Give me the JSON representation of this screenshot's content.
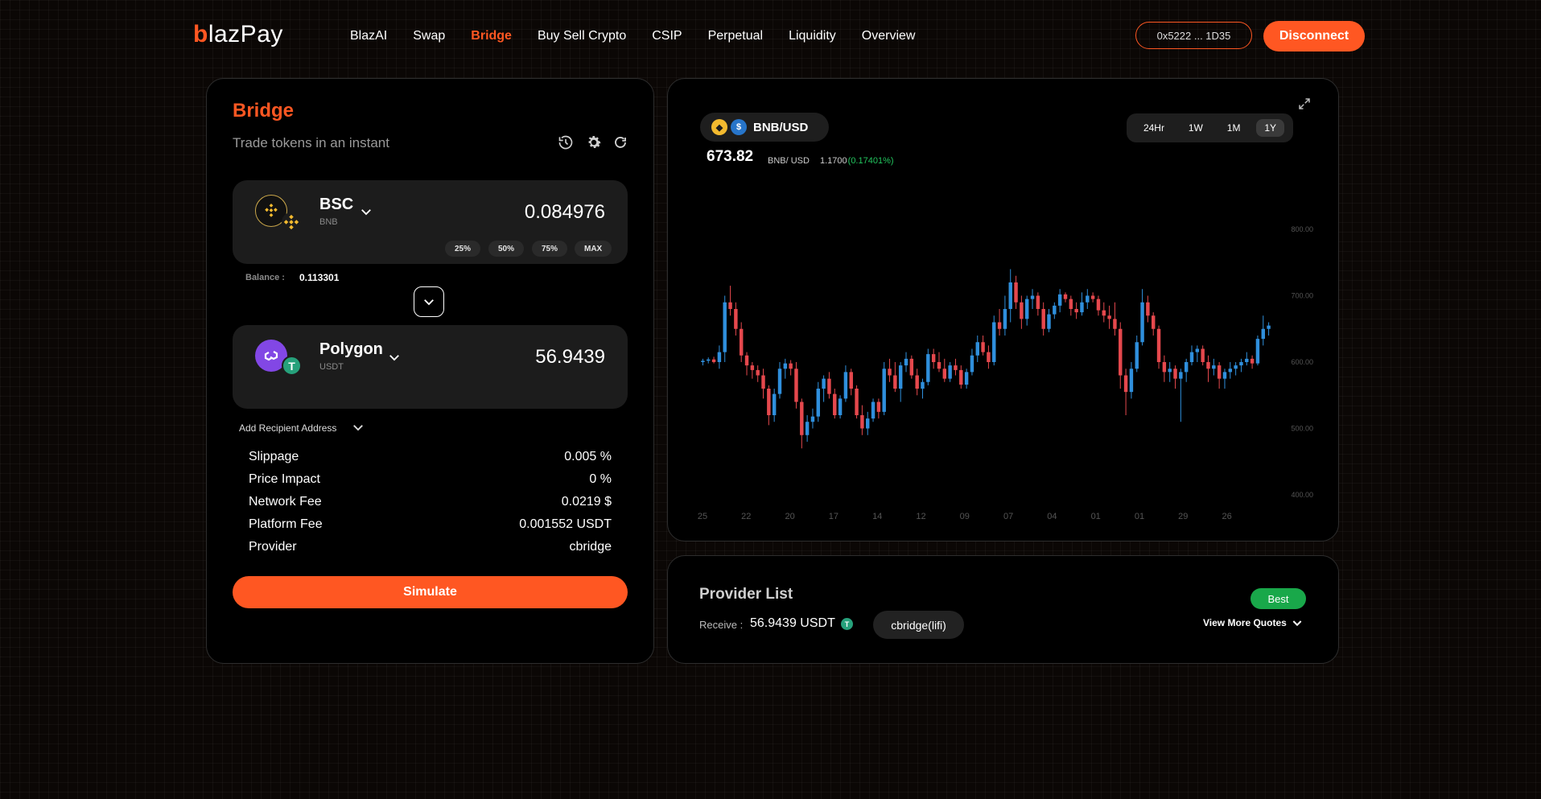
{
  "brand": {
    "logo_first": "b",
    "logo_rest": "lazPay"
  },
  "nav": {
    "items": [
      {
        "label": "BlazAI",
        "active": false
      },
      {
        "label": "Swap",
        "active": false
      },
      {
        "label": "Bridge",
        "active": true
      },
      {
        "label": "Buy Sell Crypto",
        "active": false
      },
      {
        "label": "CSIP",
        "active": false
      },
      {
        "label": "Perpetual",
        "active": false
      },
      {
        "label": "Liquidity",
        "active": false
      },
      {
        "label": "Overview",
        "active": false
      }
    ],
    "wallet_address": "0x5222 ... 1D35",
    "disconnect_label": "Disconnect"
  },
  "bridge": {
    "title": "Bridge",
    "subtitle": "Trade tokens in an instant",
    "from": {
      "chain": "BSC",
      "token": "BNB",
      "amount": "0.084976"
    },
    "pct_buttons": [
      "25%",
      "50%",
      "75%",
      "MAX"
    ],
    "balance_label": "Balance :",
    "balance_value": "0.113301",
    "to": {
      "chain": "Polygon",
      "token": "USDT",
      "amount": "56.9439"
    },
    "recipient_label": "Add Recipient Address",
    "details": [
      {
        "label": "Slippage",
        "value": "0.005 %"
      },
      {
        "label": "Price Impact",
        "value": "0 %"
      },
      {
        "label": "Network Fee",
        "value": "0.0219 $"
      },
      {
        "label": "Platform Fee",
        "value": "0.001552 USDT"
      },
      {
        "label": "Provider",
        "value": "cbridge"
      }
    ],
    "simulate_label": "Simulate"
  },
  "chart": {
    "pair": "BNB/USD",
    "price": "673.82",
    "price_unit": "BNB/ USD",
    "change_abs": "1.1700",
    "change_pct": "(0.17401%)",
    "timeframes": [
      {
        "label": "24Hr",
        "active": false
      },
      {
        "label": "1W",
        "active": false
      },
      {
        "label": "1M",
        "active": false
      },
      {
        "label": "1Y",
        "active": true
      }
    ],
    "colors": {
      "up": "#2f8fdc",
      "down": "#e5484d",
      "accent": "#ff5722",
      "positive": "#22c55e"
    }
  },
  "chart_data": {
    "type": "candlestick",
    "title": "",
    "xlabel": "",
    "ylabel": "",
    "x_ticks": [
      "25",
      "22",
      "20",
      "17",
      "14",
      "12",
      "09",
      "07",
      "04",
      "01",
      "01",
      "29",
      "26"
    ],
    "y_ticks": [
      "800.00",
      "700.00",
      "600.00",
      "500.00",
      "400.00"
    ],
    "ylim": [
      400,
      800
    ],
    "grid": false,
    "candles": [
      [
        600,
        605,
        595,
        602
      ],
      [
        602,
        607,
        598,
        604
      ],
      [
        604,
        608,
        598,
        600
      ],
      [
        600,
        625,
        590,
        615
      ],
      [
        615,
        700,
        600,
        690
      ],
      [
        690,
        715,
        670,
        680
      ],
      [
        680,
        690,
        640,
        650
      ],
      [
        650,
        660,
        600,
        610
      ],
      [
        610,
        615,
        580,
        595
      ],
      [
        595,
        600,
        575,
        588
      ],
      [
        588,
        595,
        570,
        580
      ],
      [
        580,
        590,
        545,
        560
      ],
      [
        560,
        565,
        505,
        520
      ],
      [
        520,
        560,
        510,
        552
      ],
      [
        552,
        600,
        545,
        590
      ],
      [
        590,
        605,
        575,
        598
      ],
      [
        598,
        603,
        580,
        590
      ],
      [
        590,
        600,
        530,
        540
      ],
      [
        540,
        545,
        470,
        490
      ],
      [
        490,
        520,
        480,
        510
      ],
      [
        510,
        530,
        500,
        518
      ],
      [
        518,
        570,
        510,
        560
      ],
      [
        560,
        580,
        540,
        575
      ],
      [
        575,
        585,
        545,
        552
      ],
      [
        552,
        560,
        515,
        520
      ],
      [
        520,
        550,
        515,
        545
      ],
      [
        545,
        595,
        540,
        585
      ],
      [
        585,
        590,
        550,
        560
      ],
      [
        560,
        565,
        515,
        520
      ],
      [
        520,
        535,
        490,
        500
      ],
      [
        500,
        525,
        490,
        515
      ],
      [
        515,
        545,
        510,
        540
      ],
      [
        540,
        545,
        515,
        525
      ],
      [
        525,
        600,
        520,
        590
      ],
      [
        590,
        605,
        570,
        580
      ],
      [
        580,
        600,
        555,
        560
      ],
      [
        560,
        600,
        540,
        595
      ],
      [
        595,
        615,
        585,
        605
      ],
      [
        605,
        610,
        575,
        580
      ],
      [
        580,
        590,
        550,
        560
      ],
      [
        560,
        575,
        545,
        570
      ],
      [
        570,
        620,
        565,
        612
      ],
      [
        612,
        620,
        590,
        600
      ],
      [
        600,
        615,
        585,
        590
      ],
      [
        590,
        605,
        570,
        575
      ],
      [
        575,
        600,
        570,
        595
      ],
      [
        595,
        605,
        580,
        588
      ],
      [
        588,
        595,
        560,
        566
      ],
      [
        566,
        590,
        560,
        585
      ],
      [
        585,
        620,
        580,
        610
      ],
      [
        610,
        640,
        600,
        630
      ],
      [
        630,
        640,
        610,
        615
      ],
      [
        615,
        625,
        590,
        600
      ],
      [
        600,
        670,
        595,
        660
      ],
      [
        660,
        680,
        640,
        650
      ],
      [
        650,
        700,
        640,
        680
      ],
      [
        680,
        740,
        660,
        720
      ],
      [
        720,
        730,
        680,
        690
      ],
      [
        690,
        700,
        650,
        665
      ],
      [
        665,
        700,
        655,
        695
      ],
      [
        695,
        710,
        680,
        700
      ],
      [
        700,
        705,
        670,
        680
      ],
      [
        680,
        690,
        640,
        650
      ],
      [
        650,
        680,
        645,
        672
      ],
      [
        672,
        690,
        665,
        685
      ],
      [
        685,
        710,
        675,
        702
      ],
      [
        702,
        705,
        690,
        695
      ],
      [
        695,
        700,
        670,
        680
      ],
      [
        680,
        690,
        665,
        675
      ],
      [
        675,
        705,
        670,
        690
      ],
      [
        690,
        710,
        680,
        700
      ],
      [
        700,
        705,
        690,
        695
      ],
      [
        695,
        700,
        670,
        678
      ],
      [
        678,
        690,
        660,
        670
      ],
      [
        670,
        685,
        650,
        665
      ],
      [
        665,
        690,
        640,
        650
      ],
      [
        650,
        660,
        560,
        580
      ],
      [
        580,
        590,
        520,
        555
      ],
      [
        555,
        600,
        545,
        590
      ],
      [
        590,
        640,
        585,
        630
      ],
      [
        630,
        710,
        625,
        690
      ],
      [
        690,
        700,
        660,
        670
      ],
      [
        670,
        675,
        640,
        650
      ],
      [
        650,
        655,
        590,
        600
      ],
      [
        600,
        610,
        570,
        585
      ],
      [
        585,
        600,
        570,
        590
      ],
      [
        590,
        595,
        560,
        575
      ],
      [
        575,
        590,
        510,
        585
      ],
      [
        585,
        605,
        570,
        600
      ],
      [
        600,
        625,
        595,
        615
      ],
      [
        615,
        625,
        600,
        620
      ],
      [
        620,
        625,
        595,
        600
      ],
      [
        600,
        610,
        570,
        590
      ],
      [
        590,
        605,
        580,
        595
      ],
      [
        595,
        600,
        560,
        575
      ],
      [
        575,
        590,
        560,
        585
      ],
      [
        585,
        600,
        575,
        590
      ],
      [
        590,
        600,
        580,
        595
      ],
      [
        595,
        605,
        585,
        600
      ],
      [
        600,
        615,
        595,
        605
      ],
      [
        605,
        610,
        590,
        598
      ],
      [
        598,
        640,
        595,
        635
      ],
      [
        635,
        670,
        625,
        650
      ],
      [
        650,
        660,
        640,
        655
      ]
    ]
  },
  "providers": {
    "title": "Provider List",
    "receive_label": "Receive :",
    "receive_value": "56.9439 USDT",
    "provider_chip": "cbridge(lifi)",
    "best_label": "Best",
    "more_quotes_label": "View More Quotes"
  }
}
